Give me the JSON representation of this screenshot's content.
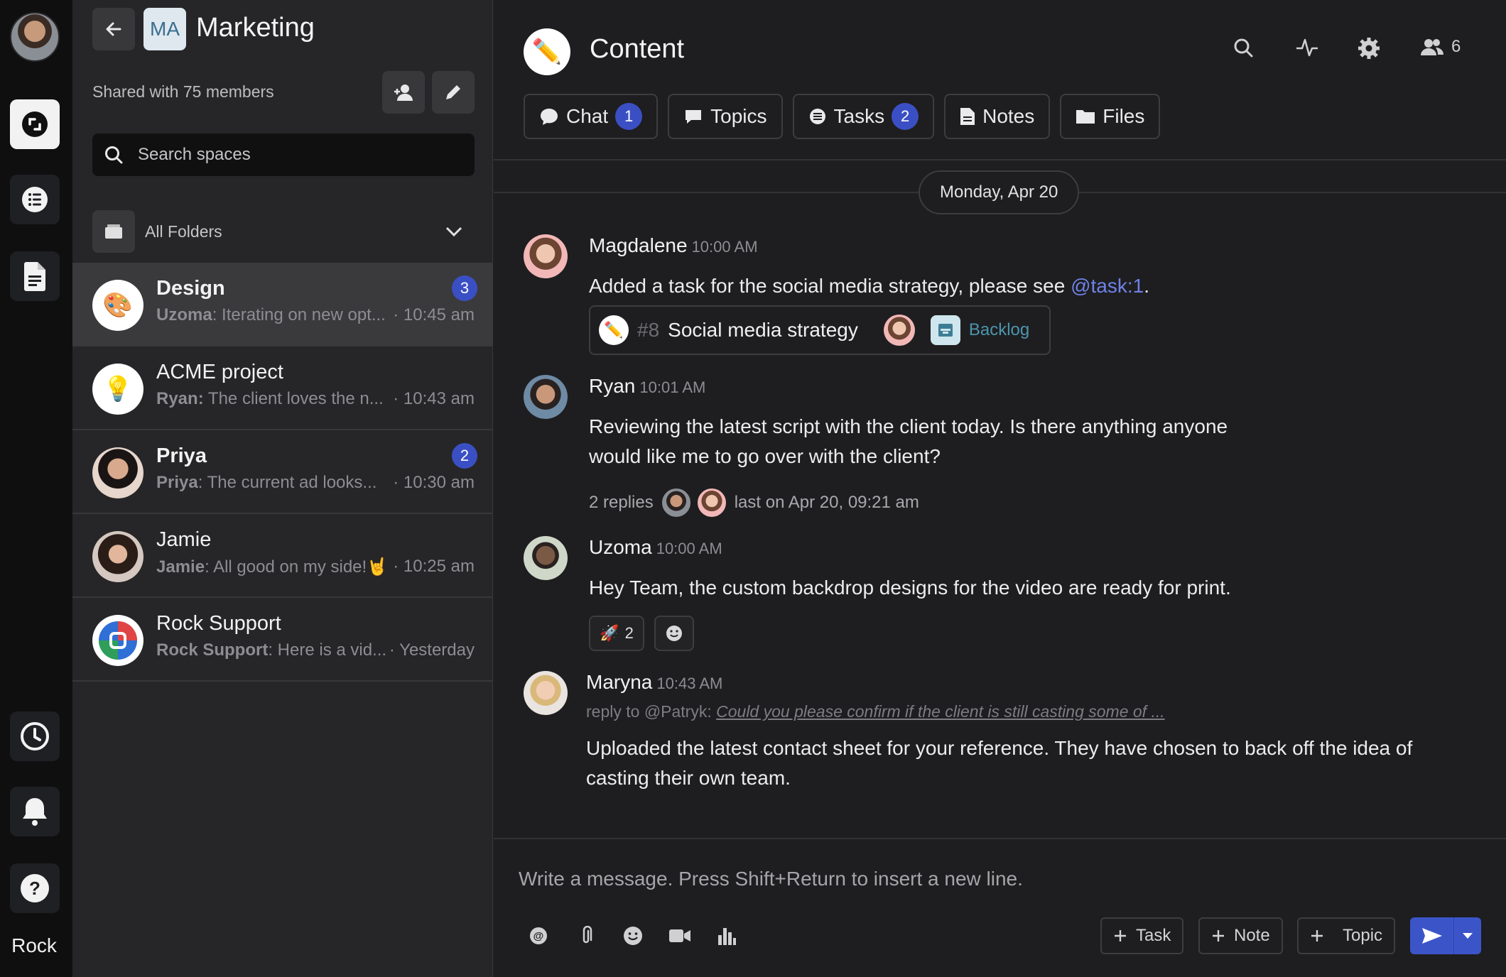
{
  "rail": {
    "label": "Rock",
    "items": [
      "spaces-icon",
      "list-icon",
      "document-icon",
      "history-icon",
      "bell-icon",
      "help-icon"
    ]
  },
  "sidebar": {
    "space_badge": "MA",
    "space_name": "Marketing",
    "shared": "Shared with 75 members",
    "search_placeholder": "Search spaces",
    "folders_label": "All Folders",
    "items": [
      {
        "name": "Design",
        "sender": "Uzoma",
        "preview": ": Iterating on new opt...",
        "time": "· 10:45 am",
        "badge": "3",
        "icon": "🎨"
      },
      {
        "name": "ACME project",
        "sender": "Ryan:",
        "preview": " The client loves the n...",
        "time": "· 10:43 am",
        "badge": "",
        "icon": "💡"
      },
      {
        "name": "Priya",
        "sender": "Priya",
        "preview": ": The current ad looks...",
        "time": "· 10:30 am",
        "badge": "2",
        "icon": ""
      },
      {
        "name": "Jamie",
        "sender": "Jamie",
        "preview": ": All good on my side!🤘",
        "time": "· 10:25 am",
        "badge": "",
        "icon": ""
      },
      {
        "name": "Rock Support",
        "sender": "Rock Support",
        "preview": ": Here is a vid...",
        "time": "· Yesterday",
        "badge": "",
        "icon": ""
      }
    ]
  },
  "channel": {
    "icon": "✏️",
    "title": "Content",
    "members_count": "6",
    "tabs": [
      {
        "label": "Chat",
        "count": "1"
      },
      {
        "label": "Topics",
        "count": ""
      },
      {
        "label": "Tasks",
        "count": "2"
      },
      {
        "label": "Notes",
        "count": ""
      },
      {
        "label": "Files",
        "count": ""
      }
    ],
    "date": "Monday, Apr 20"
  },
  "messages": [
    {
      "author": "Magdalene",
      "time": "10:00 AM",
      "text_before": "Added a task for the social media strategy, please see ",
      "mention": "@task:1",
      "text_after": "."
    },
    {
      "author": "Ryan",
      "time": "10:01 AM",
      "line1": "Reviewing the latest script with the client today. Is there anything anyone",
      "line2": "would like me to go over with the client?",
      "replies": "2 replies",
      "last": "last on Apr 20, 09:21 am"
    },
    {
      "author": "Uzoma",
      "time": "10:00 AM",
      "text": "Hey Team, the custom backdrop designs for the video are ready for print.",
      "reaction_emoji": "🚀",
      "reaction_count": "2"
    },
    {
      "author": "Maryna",
      "time": "10:43 AM",
      "reply_prefix": "reply to @Patryk: ",
      "reply_quote": "Could you please confirm if the client is still casting some of ...",
      "line1": "Uploaded the latest contact sheet for your reference. They have chosen to back off the idea of",
      "line2": "casting their own team."
    }
  ],
  "task_card": {
    "icon": "✏️",
    "number": "#8",
    "name": "Social media strategy",
    "status": "Backlog"
  },
  "composer": {
    "placeholder": "Write a message. Press Shift+Return to insert a new line.",
    "task_label": "Task",
    "note_label": "Note",
    "topic_label": "Topic"
  },
  "colors": {
    "accent": "#3b4fc4",
    "mention": "#6f82e6",
    "backlog": "#4c95ad"
  }
}
